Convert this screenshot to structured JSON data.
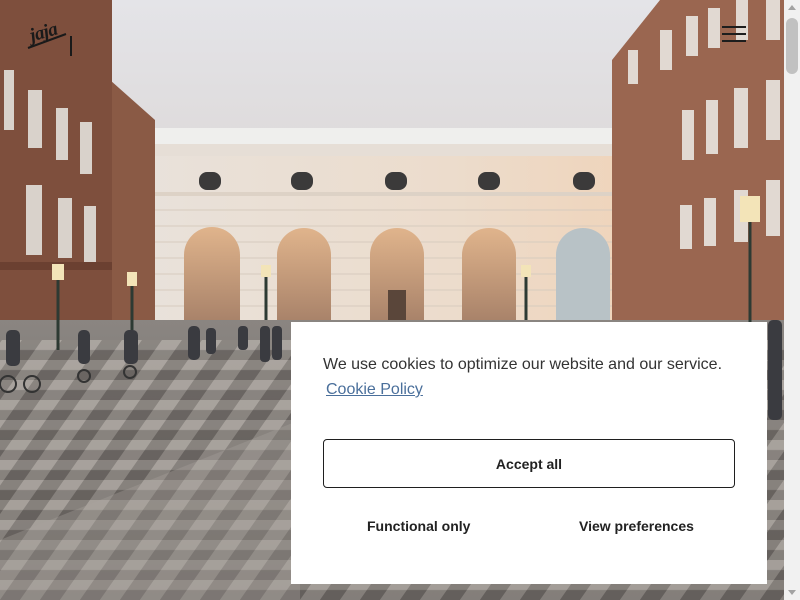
{
  "header": {
    "logo_text": "jaja",
    "menu_icon": "hamburger-menu-icon"
  },
  "cookie_banner": {
    "message": "We use cookies to optimize our website and our service.",
    "policy_link": "Cookie Policy",
    "accept_all": "Accept all",
    "functional_only": "Functional only",
    "view_preferences": "View preferences"
  },
  "colors": {
    "link": "#4a6f9b",
    "button_border": "#1f1f1f",
    "dialog_bg": "#ffffff"
  }
}
